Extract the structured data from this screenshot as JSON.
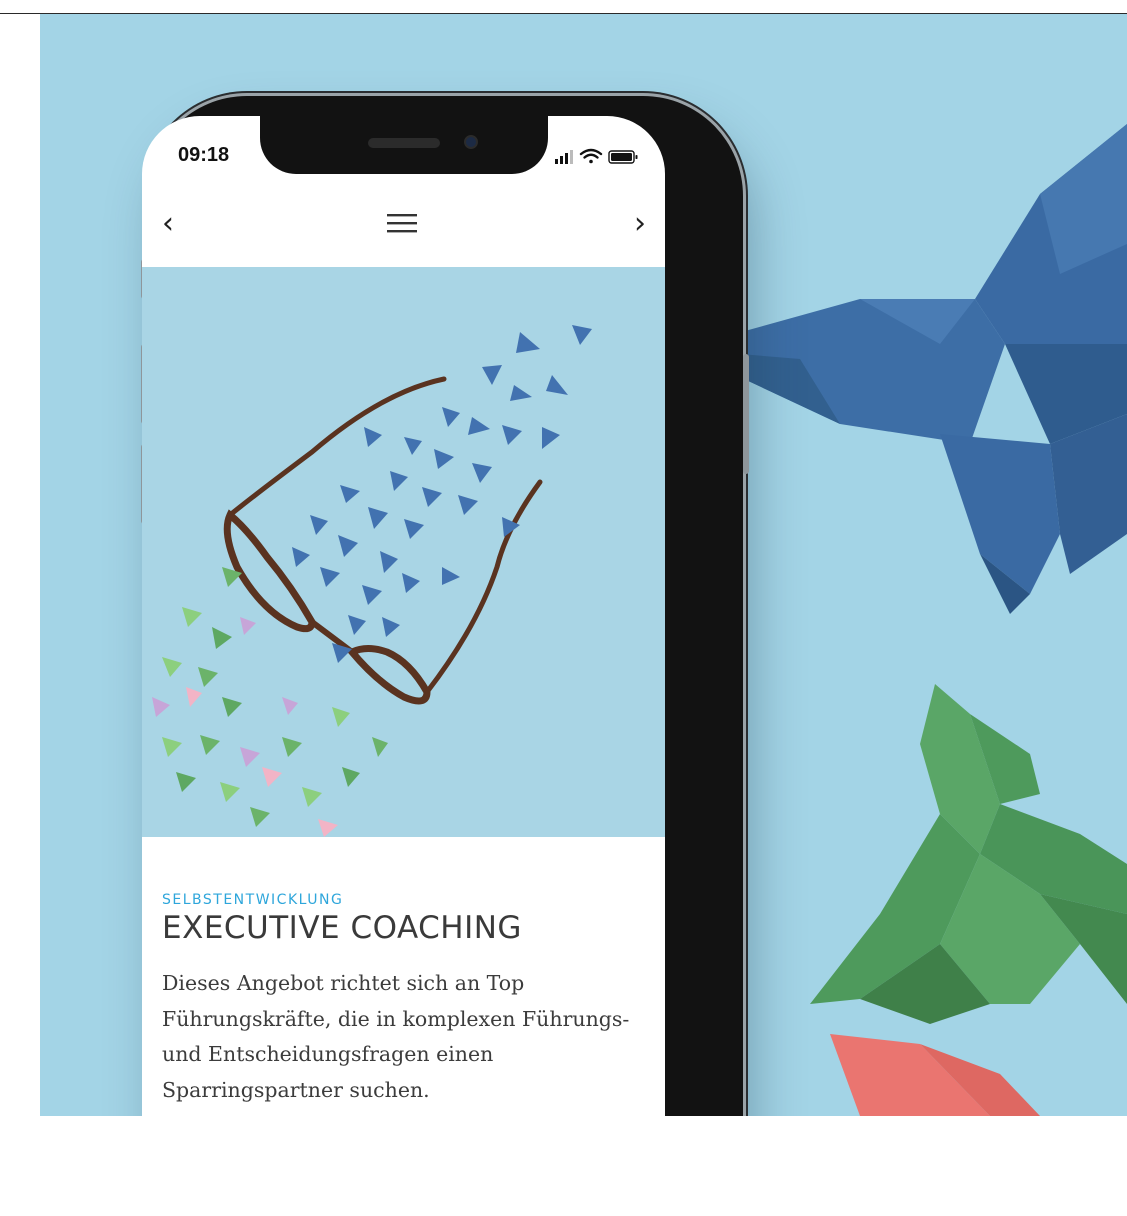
{
  "status_bar": {
    "time": "09:18",
    "signal_icon": "cellular-signal-icon",
    "wifi_icon": "wifi-icon",
    "battery_icon": "battery-icon"
  },
  "nav": {
    "back_icon": "chevron-left-icon",
    "menu_icon": "hamburger-menu-icon",
    "forward_icon": "chevron-right-icon",
    "back_glyph": "‹",
    "forward_glyph": "›"
  },
  "article": {
    "eyebrow": "SELBSTENTWICKLUNG",
    "title": "EXECUTIVE COACHING",
    "body_lines": [
      "Dieses Angebot richtet sich an Top",
      "Führungskräfte, die in komplexen Führungs-",
      "und Entscheidungsfragen einen",
      "Sparringspartner suchen."
    ]
  },
  "colors": {
    "scene_background": "#a3d4e6",
    "accent": "#2ea6db",
    "butterfly_blue": "#3a6aa3",
    "butterfly_green": "#4e9a5c",
    "butterfly_red": "#e8736e"
  }
}
